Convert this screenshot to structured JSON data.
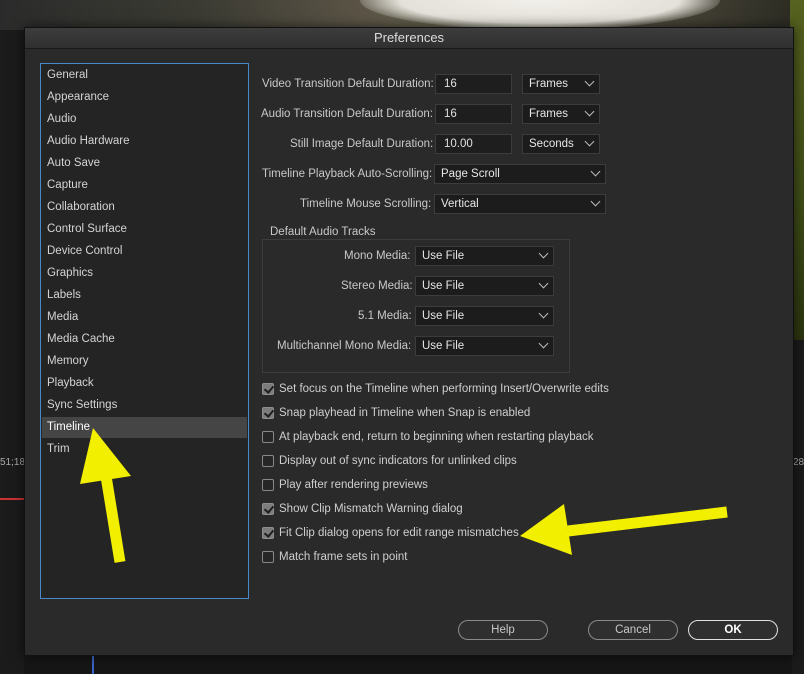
{
  "dialog": {
    "title": "Preferences"
  },
  "sidebar": {
    "items": [
      {
        "label": "General"
      },
      {
        "label": "Appearance"
      },
      {
        "label": "Audio"
      },
      {
        "label": "Audio Hardware"
      },
      {
        "label": "Auto Save"
      },
      {
        "label": "Capture"
      },
      {
        "label": "Collaboration"
      },
      {
        "label": "Control Surface"
      },
      {
        "label": "Device Control"
      },
      {
        "label": "Graphics"
      },
      {
        "label": "Labels"
      },
      {
        "label": "Media"
      },
      {
        "label": "Media Cache"
      },
      {
        "label": "Memory"
      },
      {
        "label": "Playback"
      },
      {
        "label": "Sync Settings"
      },
      {
        "label": "Timeline"
      },
      {
        "label": "Trim"
      }
    ],
    "selected": "Timeline"
  },
  "settings": {
    "video_transition": {
      "label": "Video Transition Default Duration:",
      "value": "16",
      "unit": "Frames"
    },
    "audio_transition": {
      "label": "Audio Transition Default Duration:",
      "value": "16",
      "unit": "Frames"
    },
    "still_image": {
      "label": "Still Image Default Duration:",
      "value": "10.00",
      "unit": "Seconds"
    },
    "autoscroll": {
      "label": "Timeline Playback Auto-Scrolling:",
      "value": "Page Scroll"
    },
    "mouse_scroll": {
      "label": "Timeline Mouse Scrolling:",
      "value": "Vertical"
    }
  },
  "audio_tracks": {
    "title": "Default Audio Tracks",
    "mono": {
      "label": "Mono Media:",
      "value": "Use File"
    },
    "stereo": {
      "label": "Stereo Media:",
      "value": "Use File"
    },
    "five_one": {
      "label": "5.1 Media:",
      "value": "Use File"
    },
    "multichannel": {
      "label": "Multichannel Mono Media:",
      "value": "Use File"
    }
  },
  "checkboxes": [
    {
      "label": "Set focus on the Timeline when performing Insert/Overwrite edits",
      "checked": true
    },
    {
      "label": "Snap playhead in Timeline when Snap is enabled",
      "checked": true
    },
    {
      "label": "At playback end, return to beginning when restarting playback",
      "checked": false
    },
    {
      "label": "Display out of sync indicators for unlinked clips",
      "checked": false
    },
    {
      "label": "Play after rendering previews",
      "checked": false
    },
    {
      "label": "Show Clip Mismatch Warning dialog",
      "checked": true
    },
    {
      "label": "Fit Clip dialog opens for edit range mismatches",
      "checked": true
    },
    {
      "label": "Match frame sets in point",
      "checked": false
    }
  ],
  "buttons": {
    "help": "Help",
    "cancel": "Cancel",
    "ok": "OK"
  },
  "background": {
    "left_timecode": "51;18",
    "right_timecode": "28"
  },
  "colors": {
    "arrow": "#f2f000",
    "selection_border": "#4a88c9"
  }
}
